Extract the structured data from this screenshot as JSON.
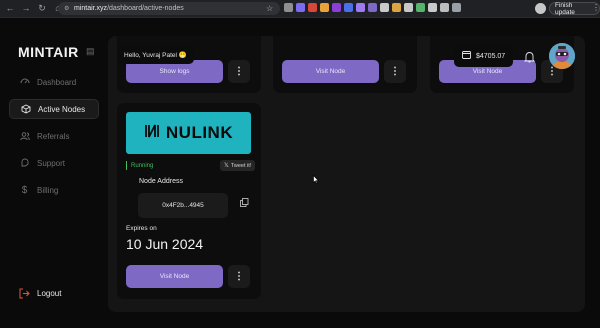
{
  "browser": {
    "nav_back": "←",
    "nav_forward": "→",
    "nav_reload": "↻",
    "nav_home": "⌂",
    "url_host": "mintair.xyz",
    "url_path": "/dashboard/active-nodes",
    "finish_update_label": "Finish update",
    "extension_colors": [
      "#8f8f8f",
      "#7c6df0",
      "#d7473a",
      "#e8a33b",
      "#8b3fd6",
      "#4a6fe8",
      "#9c7cf0",
      "#7e69c4",
      "#c9c9c9",
      "#d9a441",
      "#c8c8c8",
      "#57b36b",
      "#c9c9c9",
      "#bdbdbd",
      "#9aa0a6"
    ]
  },
  "sidebar": {
    "logo_text": "MINTAIR",
    "items": [
      {
        "label": "Dashboard",
        "icon": "dashboard-icon",
        "active": false
      },
      {
        "label": "Active Nodes",
        "icon": "cube-icon",
        "active": true
      },
      {
        "label": "Referrals",
        "icon": "users-icon",
        "active": false
      },
      {
        "label": "Support",
        "icon": "support-icon",
        "active": false
      },
      {
        "label": "Billing",
        "icon": "dollar-icon",
        "active": false
      }
    ],
    "logout_label": "Logout"
  },
  "header": {
    "greeting": "Hello, Yuvraj Patel 😁",
    "balance": "$4705.07"
  },
  "top_cards": [
    {
      "button_label": "Show logs"
    },
    {
      "button_label": "Visit Node"
    },
    {
      "button_label": "Visit Node"
    }
  ],
  "node_card": {
    "banner_text": "NULINK",
    "status": "Running",
    "tweet_label": "Tweet it!",
    "node_address_label": "Node Address",
    "node_address": "0x4F2b...4945",
    "expires_label": "Expires on",
    "expires_date": "10 Jun 2024",
    "button_label": "Visit Node"
  },
  "colors": {
    "accent": "#7e69c4",
    "banner": "#1fb3c0",
    "running": "#3fbf5e"
  }
}
